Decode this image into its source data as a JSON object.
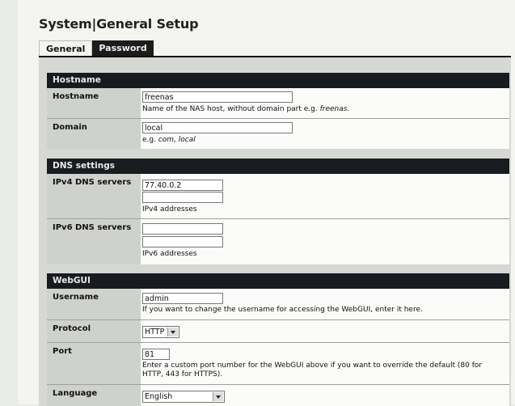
{
  "header": {
    "title": "System|General Setup"
  },
  "tabs": [
    {
      "label": "General"
    },
    {
      "label": "Password"
    }
  ],
  "sections": {
    "hostname": {
      "title": "Hostname",
      "hostname": {
        "label": "Hostname",
        "value": "freenas",
        "help_prefix": "Name of the NAS host, without domain part e.g. ",
        "help_example": "freenas."
      },
      "domain": {
        "label": "Domain",
        "value": "local",
        "help_prefix": "e.g. ",
        "help_example": "com, local"
      }
    },
    "dns": {
      "title": "DNS settings",
      "ipv4": {
        "label": "IPv4 DNS servers",
        "value1": "77.40.0.2",
        "value2": "",
        "help": "IPv4 addresses"
      },
      "ipv6": {
        "label": "IPv6 DNS servers",
        "value1": "",
        "value2": "",
        "help": "IPv6 addresses"
      }
    },
    "webgui": {
      "title": "WebGUI",
      "username": {
        "label": "Username",
        "value": "admin",
        "help": "If you want to change the username for accessing the WebGUI, enter it here."
      },
      "protocol": {
        "label": "Protocol",
        "value": "HTTP"
      },
      "port": {
        "label": "Port",
        "value": "81",
        "help_line1": "Enter a custom port number for the WebGUI above if you want to override the default (80 for",
        "help_line2": "HTTP, 443 for HTTPS)."
      },
      "language": {
        "label": "Language",
        "value": "English"
      }
    }
  }
}
